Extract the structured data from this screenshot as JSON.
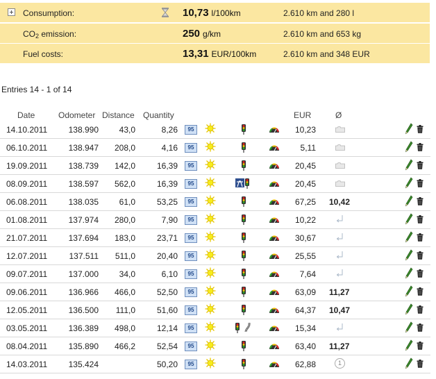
{
  "summary": {
    "consumption": {
      "label": "Consumption:",
      "value": "10,73",
      "unit": "l/100km",
      "detail": "2.610 km and 280 l"
    },
    "co2": {
      "label_pre": "CO",
      "label_sub": "2",
      "label_post": " emission:",
      "value": "250",
      "unit": "g/km",
      "detail": "2.610 km and 653 kg"
    },
    "fuel_costs": {
      "label": "Fuel costs:",
      "value": "13,31",
      "unit": "EUR/100km",
      "detail": "2.610 km and 348 EUR"
    }
  },
  "entries_text": "Entries 14 - 1 of 14",
  "columns": {
    "date": "Date",
    "odometer": "Odometer",
    "distance": "Distance",
    "quantity": "Quantity",
    "eur": "EUR",
    "avg": "Ø"
  },
  "fuel_badge": "95",
  "circle_badge": "1",
  "rows": [
    {
      "date": "14.10.2011",
      "odometer": "138.990",
      "distance": "43,0",
      "quantity": "8,26",
      "eur": "10,23",
      "avg": "",
      "route": "city",
      "marker": "tank"
    },
    {
      "date": "06.10.2011",
      "odometer": "138.947",
      "distance": "208,0",
      "quantity": "4,16",
      "eur": "5,11",
      "avg": "",
      "route": "city",
      "marker": "tank"
    },
    {
      "date": "19.09.2011",
      "odometer": "138.739",
      "distance": "142,0",
      "quantity": "16,39",
      "eur": "20,45",
      "avg": "",
      "route": "city",
      "marker": "tank"
    },
    {
      "date": "08.09.2011",
      "odometer": "138.597",
      "distance": "562,0",
      "quantity": "16,39",
      "eur": "20,45",
      "avg": "",
      "route": "highway-city",
      "marker": "tank"
    },
    {
      "date": "06.08.2011",
      "odometer": "138.035",
      "distance": "61,0",
      "quantity": "53,25",
      "eur": "67,25",
      "avg": "10,42",
      "route": "city",
      "marker": ""
    },
    {
      "date": "01.08.2011",
      "odometer": "137.974",
      "distance": "280,0",
      "quantity": "7,90",
      "eur": "10,22",
      "avg": "",
      "route": "city",
      "marker": "return"
    },
    {
      "date": "21.07.2011",
      "odometer": "137.694",
      "distance": "183,0",
      "quantity": "23,71",
      "eur": "30,67",
      "avg": "",
      "route": "city",
      "marker": "return"
    },
    {
      "date": "12.07.2011",
      "odometer": "137.511",
      "distance": "511,0",
      "quantity": "20,40",
      "eur": "25,55",
      "avg": "",
      "route": "city",
      "marker": "return"
    },
    {
      "date": "09.07.2011",
      "odometer": "137.000",
      "distance": "34,0",
      "quantity": "6,10",
      "eur": "7,64",
      "avg": "",
      "route": "city",
      "marker": "return"
    },
    {
      "date": "09.06.2011",
      "odometer": "136.966",
      "distance": "466,0",
      "quantity": "52,50",
      "eur": "63,09",
      "avg": "11,27",
      "route": "city",
      "marker": ""
    },
    {
      "date": "12.05.2011",
      "odometer": "136.500",
      "distance": "111,0",
      "quantity": "51,60",
      "eur": "64,37",
      "avg": "10,47",
      "route": "city",
      "marker": ""
    },
    {
      "date": "03.05.2011",
      "odometer": "136.389",
      "distance": "498,0",
      "quantity": "12,14",
      "eur": "15,34",
      "avg": "",
      "route": "city-road",
      "marker": "return"
    },
    {
      "date": "08.04.2011",
      "odometer": "135.890",
      "distance": "466,2",
      "quantity": "52,54",
      "eur": "63,40",
      "avg": "11,27",
      "route": "city",
      "marker": ""
    },
    {
      "date": "14.03.2011",
      "odometer": "135.424",
      "distance": "",
      "quantity": "50,20",
      "eur": "62,88",
      "avg": "",
      "route": "city",
      "marker": "circle"
    }
  ],
  "colors": {
    "summary_bg": "#fbe7a1",
    "row_border": "#d8d8d8",
    "fuel_badge_bg": "#cfe0f5"
  }
}
